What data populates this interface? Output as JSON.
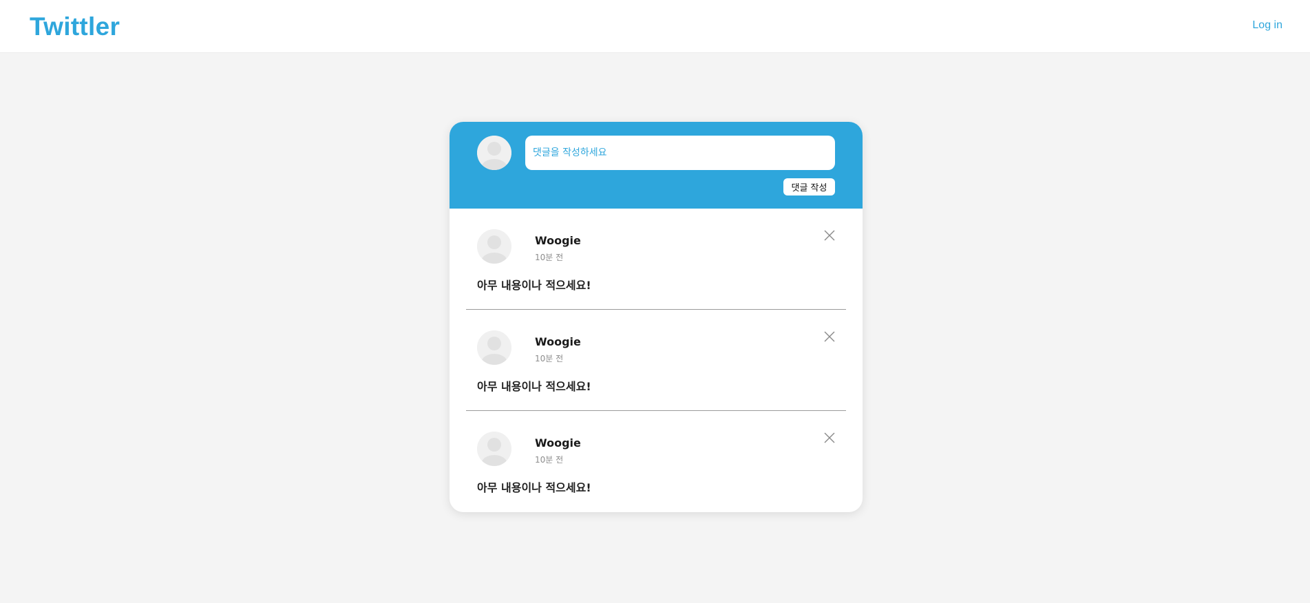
{
  "header": {
    "logo": "Twittler",
    "login_label": "Log in"
  },
  "composer": {
    "placeholder": "댓글을 작성하세요",
    "value": "",
    "submit_label": "댓글 작성"
  },
  "comments": [
    {
      "author": "Woogie",
      "time": "10분 전",
      "text": "아무 내용이나 적으세요!"
    },
    {
      "author": "Woogie",
      "time": "10분 전",
      "text": "아무 내용이나 적으세요!"
    },
    {
      "author": "Woogie",
      "time": "10분 전",
      "text": "아무 내용이나 적으세요!"
    }
  ],
  "icons": {
    "avatar": "user-avatar-icon",
    "delete": "close-icon"
  },
  "colors": {
    "accent": "#2ea6dc",
    "background": "#f4f4f4",
    "card": "#ffffff",
    "divider": "#9a9a9a"
  }
}
